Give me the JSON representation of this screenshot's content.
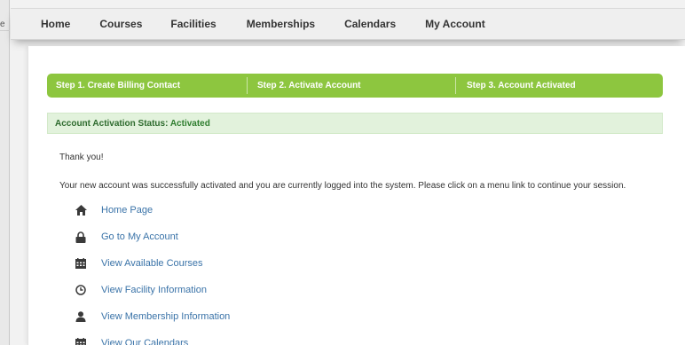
{
  "left_fragment": "e",
  "nav": {
    "items": [
      "Home",
      "Courses",
      "Facilities",
      "Memberships",
      "Calendars",
      "My Account"
    ]
  },
  "steps": {
    "step1": "Step 1. Create Billing Contact",
    "step2": "Step 2. Activate Account",
    "step3": "Step 3. Account Activated"
  },
  "status": {
    "label": "Account Activation Status: ",
    "value": "Activated"
  },
  "thanks": "Thank you!",
  "message": "Your new account was successfully activated and you are currently logged into the system. Please click on a menu link to continue your session.",
  "links": [
    {
      "label": "Home Page",
      "icon": "home-icon"
    },
    {
      "label": "Go to My Account",
      "icon": "lock-icon"
    },
    {
      "label": "View Available Courses",
      "icon": "calendar-icon"
    },
    {
      "label": "View Facility Information",
      "icon": "clock-icon"
    },
    {
      "label": "View Membership Information",
      "icon": "user-icon"
    },
    {
      "label": "View Our Calendars",
      "icon": "calendar-icon"
    }
  ],
  "colors": {
    "accent_green": "#8dc63f",
    "status_bg": "#e2f2dc",
    "link_blue": "#3a73a8",
    "icon_dark": "#3a3a3a"
  }
}
